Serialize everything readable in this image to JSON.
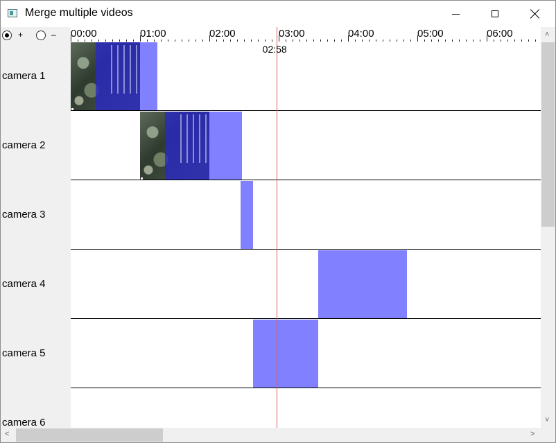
{
  "window": {
    "title": "Merge multiple videos",
    "controls": {
      "minimize": "minimize",
      "maximize": "maximize",
      "close": "close"
    }
  },
  "zoom": {
    "plus_label": "+",
    "minus_label": "–",
    "selected": "plus"
  },
  "ruler": {
    "ticks": [
      "00:00",
      "01:00",
      "02:00",
      "03:00",
      "04:00",
      "05:00",
      "06:00"
    ]
  },
  "playhead": {
    "time": "02:58"
  },
  "cameras": [
    {
      "label": "camera 1",
      "clips": [
        {
          "start": "00:00",
          "end": "01:15",
          "thumbnail": true
        }
      ]
    },
    {
      "label": "camera 2",
      "clips": [
        {
          "start": "01:00",
          "end": "02:28",
          "thumbnail": true
        }
      ]
    },
    {
      "label": "camera 3",
      "clips": [
        {
          "start": "02:27",
          "end": "02:38",
          "thumbnail": false
        }
      ]
    },
    {
      "label": "camera 4",
      "clips": [
        {
          "start": "03:34",
          "end": "04:51",
          "thumbnail": false
        }
      ]
    },
    {
      "label": "camera 5",
      "clips": [
        {
          "start": "02:38",
          "end": "03:34",
          "thumbnail": false
        }
      ]
    },
    {
      "label": "camera 6",
      "clips": []
    }
  ],
  "colors": {
    "clip_fill": "#6262ff",
    "playhead": "#e05a5a",
    "label_panel": "#f0f0f0"
  },
  "icons": {
    "app": "video-merge-app-icon",
    "minimize": "minimize-icon",
    "maximize": "maximize-icon",
    "close": "close-icon",
    "scroll_up": "chevron-up-icon",
    "scroll_down": "chevron-down-icon",
    "scroll_left": "chevron-left-icon",
    "scroll_right": "chevron-right-icon"
  }
}
